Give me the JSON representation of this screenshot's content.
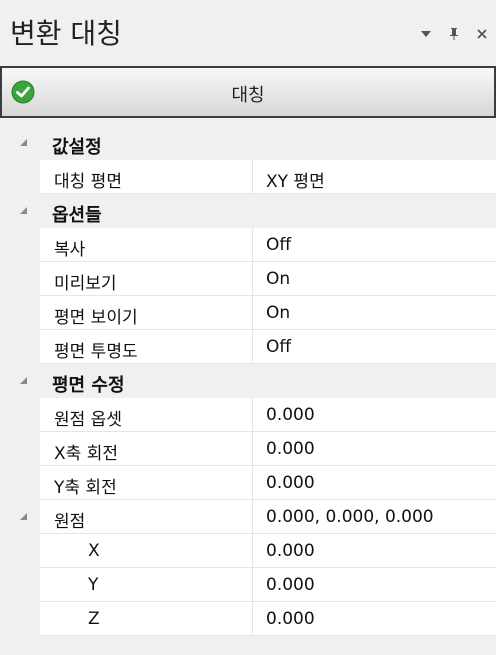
{
  "panel": {
    "title": "변환 대칭"
  },
  "header": {
    "label": "대칭",
    "icon": "check-circle-icon",
    "icon_color": "#3aa53a"
  },
  "sections": [
    {
      "title": "값설정",
      "rows": [
        {
          "name": "대칭 평면",
          "value": "XY 평면"
        }
      ]
    },
    {
      "title": "옵션들",
      "rows": [
        {
          "name": "복사",
          "value": "Off"
        },
        {
          "name": "미리보기",
          "value": "On"
        },
        {
          "name": "평면 보이기",
          "value": "On"
        },
        {
          "name": "평면 투명도",
          "value": "Off"
        }
      ]
    },
    {
      "title": "평면 수정",
      "rows": [
        {
          "name": "원점 옵셋",
          "value": "0.000"
        },
        {
          "name": "X축 회전",
          "value": "0.000"
        },
        {
          "name": "Y축 회전",
          "value": "0.000"
        },
        {
          "name": "원점",
          "value": "0.000, 0.000, 0.000"
        },
        {
          "name": "X",
          "value": "0.000"
        },
        {
          "name": "Y",
          "value": "0.000"
        },
        {
          "name": "Z",
          "value": "0.000"
        }
      ]
    }
  ]
}
